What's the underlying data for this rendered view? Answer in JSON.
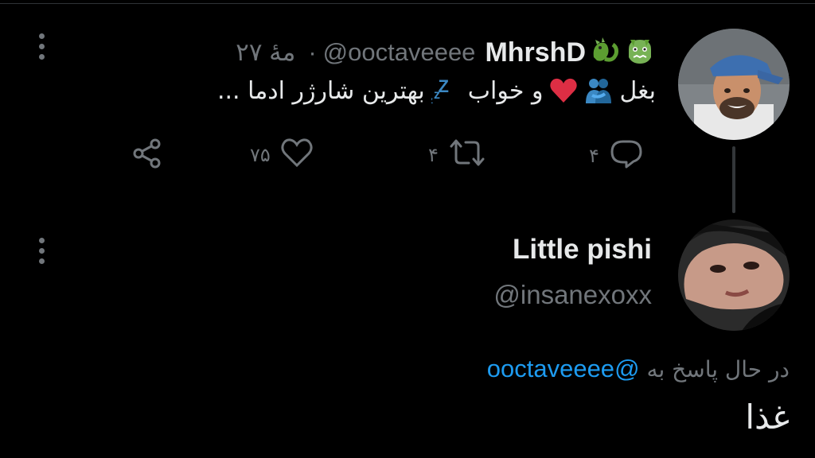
{
  "tweet": {
    "author_name": "MhrshD",
    "author_handle": "@ooctaveeee",
    "separator": "·",
    "time": "۲۷ مهٔ",
    "text_part1": "بغل",
    "text_part2": "و خواب",
    "text_part3": "بهترین شارژر ادما ...",
    "zzz": "zzZ",
    "name_emojis": [
      "dragon-emoji",
      "dragon-face-emoji"
    ],
    "actions": {
      "reply_count": "۴",
      "retweet_count": "۴",
      "like_count": "۷۵"
    }
  },
  "reply": {
    "author_name": "Little pishi",
    "author_handle": "@insanexoxx",
    "replying_prefix": "در حال پاسخ به",
    "replying_to": "@ooctaveeee",
    "text": "غذا"
  },
  "colors": {
    "background": "#000000",
    "text": "#e7e9ea",
    "muted": "#71767b",
    "link": "#1d9bf0",
    "heart_red": "#dd2e44"
  }
}
